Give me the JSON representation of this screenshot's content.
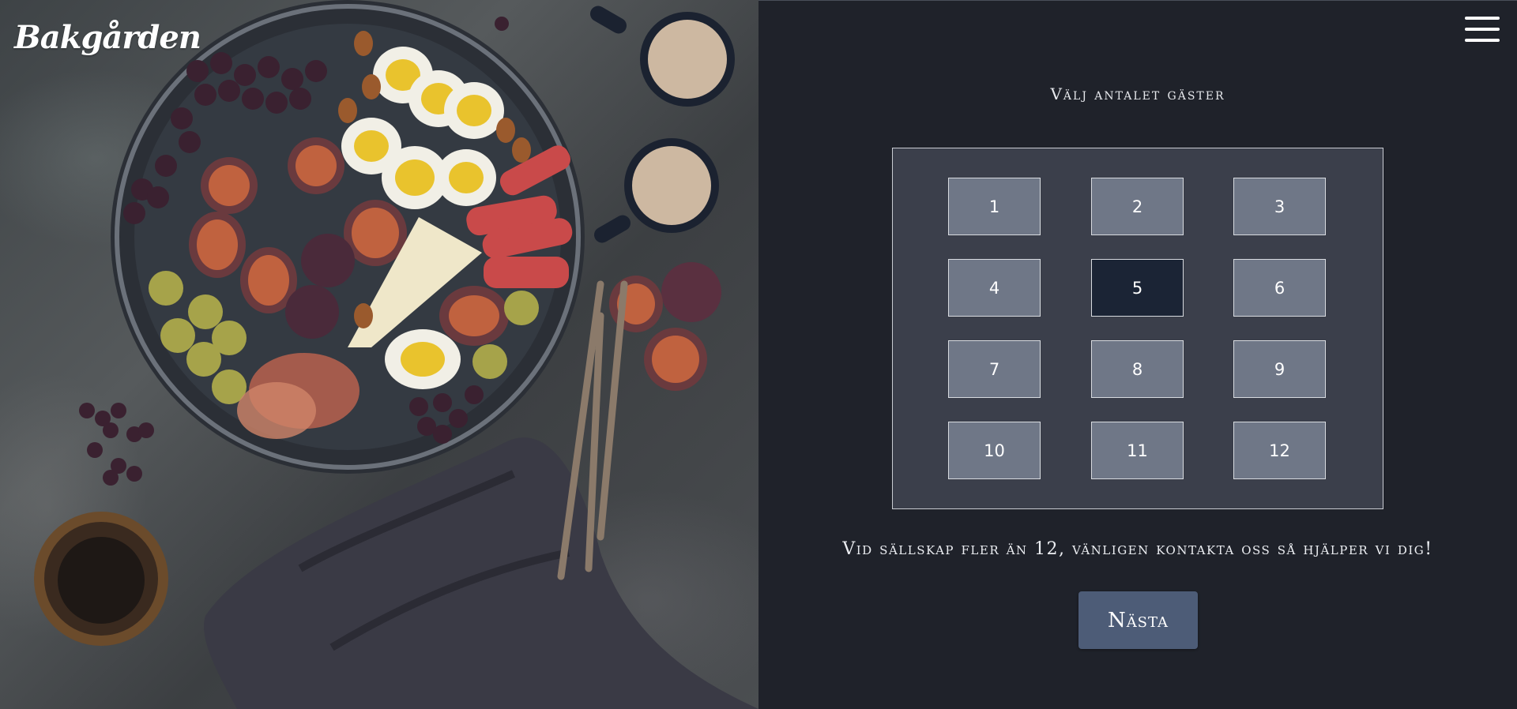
{
  "brand": {
    "logo_text": "Bakgården"
  },
  "header": {
    "menu_icon": "hamburger-menu-icon"
  },
  "guests": {
    "heading": "Välj antalet gäster",
    "options": [
      "1",
      "2",
      "3",
      "4",
      "5",
      "6",
      "7",
      "8",
      "9",
      "10",
      "11",
      "12"
    ],
    "selected": "5",
    "note": "Vid sällskap fler än 12, vänligen kontakta oss så hjälper vi dig!",
    "next_label": "Nästa"
  },
  "colors": {
    "background": "#1f222a",
    "grid_box": "#3b3f4b",
    "option": "#6f7787",
    "option_selected": "#1b2435",
    "next_button": "#4d5c77"
  }
}
